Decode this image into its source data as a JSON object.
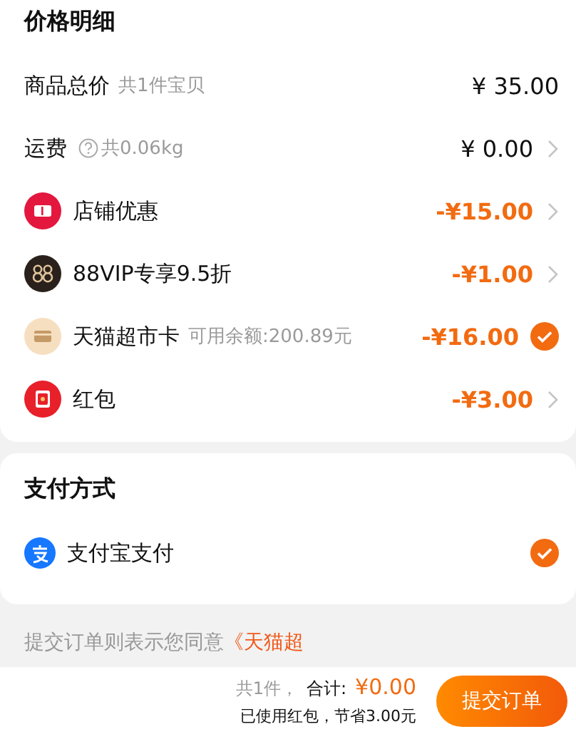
{
  "price_details": {
    "title": "价格明细",
    "rows": [
      {
        "kind": "plain",
        "label": "商品总价",
        "note": "共1件宝贝",
        "amount": "¥ 35.00"
      },
      {
        "kind": "link",
        "label": "运费",
        "note": "共0.06kg",
        "amount": "¥ 0.00"
      },
      {
        "kind": "option",
        "label": "店铺优惠",
        "amount": "-¥15.00",
        "selected": false
      },
      {
        "kind": "option",
        "label": "88VIP专享9.5折",
        "amount": "-¥1.00",
        "selected": false
      },
      {
        "kind": "option",
        "label": "天猫超市卡",
        "note": "可用余额:200.89元",
        "amount": "-¥16.00",
        "selected": true
      },
      {
        "kind": "option",
        "label": "红包",
        "amount": "-¥3.00",
        "selected": false
      }
    ]
  },
  "payment": {
    "title": "支付方式",
    "methods": [
      {
        "label": "支付宝支付",
        "selected": true
      }
    ]
  },
  "agreement": {
    "text": "提交订单则表示您同意",
    "link": "《天猫超"
  },
  "footer": {
    "count": "共1件，",
    "total_label": "合计:",
    "total": "¥0.00",
    "savings": "已使用红包，节省3.00元",
    "submit": "提交订单"
  }
}
